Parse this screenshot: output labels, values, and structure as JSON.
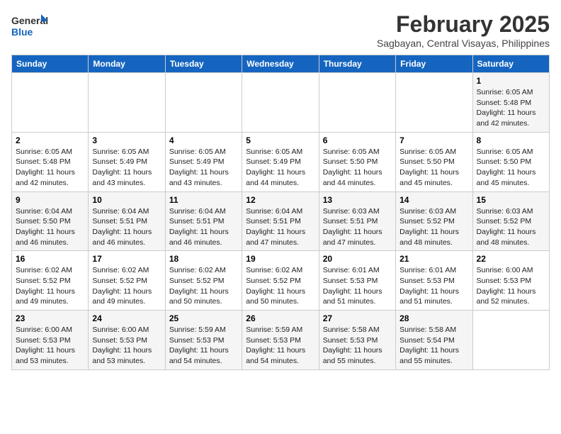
{
  "header": {
    "logo_line1": "General",
    "logo_line2": "Blue",
    "month": "February 2025",
    "location": "Sagbayan, Central Visayas, Philippines"
  },
  "weekdays": [
    "Sunday",
    "Monday",
    "Tuesday",
    "Wednesday",
    "Thursday",
    "Friday",
    "Saturday"
  ],
  "weeks": [
    [
      {
        "day": "",
        "info": ""
      },
      {
        "day": "",
        "info": ""
      },
      {
        "day": "",
        "info": ""
      },
      {
        "day": "",
        "info": ""
      },
      {
        "day": "",
        "info": ""
      },
      {
        "day": "",
        "info": ""
      },
      {
        "day": "1",
        "info": "Sunrise: 6:05 AM\nSunset: 5:48 PM\nDaylight: 11 hours and 42 minutes."
      }
    ],
    [
      {
        "day": "2",
        "info": "Sunrise: 6:05 AM\nSunset: 5:48 PM\nDaylight: 11 hours and 42 minutes."
      },
      {
        "day": "3",
        "info": "Sunrise: 6:05 AM\nSunset: 5:49 PM\nDaylight: 11 hours and 43 minutes."
      },
      {
        "day": "4",
        "info": "Sunrise: 6:05 AM\nSunset: 5:49 PM\nDaylight: 11 hours and 43 minutes."
      },
      {
        "day": "5",
        "info": "Sunrise: 6:05 AM\nSunset: 5:49 PM\nDaylight: 11 hours and 44 minutes."
      },
      {
        "day": "6",
        "info": "Sunrise: 6:05 AM\nSunset: 5:50 PM\nDaylight: 11 hours and 44 minutes."
      },
      {
        "day": "7",
        "info": "Sunrise: 6:05 AM\nSunset: 5:50 PM\nDaylight: 11 hours and 45 minutes."
      },
      {
        "day": "8",
        "info": "Sunrise: 6:05 AM\nSunset: 5:50 PM\nDaylight: 11 hours and 45 minutes."
      }
    ],
    [
      {
        "day": "9",
        "info": "Sunrise: 6:04 AM\nSunset: 5:50 PM\nDaylight: 11 hours and 46 minutes."
      },
      {
        "day": "10",
        "info": "Sunrise: 6:04 AM\nSunset: 5:51 PM\nDaylight: 11 hours and 46 minutes."
      },
      {
        "day": "11",
        "info": "Sunrise: 6:04 AM\nSunset: 5:51 PM\nDaylight: 11 hours and 46 minutes."
      },
      {
        "day": "12",
        "info": "Sunrise: 6:04 AM\nSunset: 5:51 PM\nDaylight: 11 hours and 47 minutes."
      },
      {
        "day": "13",
        "info": "Sunrise: 6:03 AM\nSunset: 5:51 PM\nDaylight: 11 hours and 47 minutes."
      },
      {
        "day": "14",
        "info": "Sunrise: 6:03 AM\nSunset: 5:52 PM\nDaylight: 11 hours and 48 minutes."
      },
      {
        "day": "15",
        "info": "Sunrise: 6:03 AM\nSunset: 5:52 PM\nDaylight: 11 hours and 48 minutes."
      }
    ],
    [
      {
        "day": "16",
        "info": "Sunrise: 6:02 AM\nSunset: 5:52 PM\nDaylight: 11 hours and 49 minutes."
      },
      {
        "day": "17",
        "info": "Sunrise: 6:02 AM\nSunset: 5:52 PM\nDaylight: 11 hours and 49 minutes."
      },
      {
        "day": "18",
        "info": "Sunrise: 6:02 AM\nSunset: 5:52 PM\nDaylight: 11 hours and 50 minutes."
      },
      {
        "day": "19",
        "info": "Sunrise: 6:02 AM\nSunset: 5:52 PM\nDaylight: 11 hours and 50 minutes."
      },
      {
        "day": "20",
        "info": "Sunrise: 6:01 AM\nSunset: 5:53 PM\nDaylight: 11 hours and 51 minutes."
      },
      {
        "day": "21",
        "info": "Sunrise: 6:01 AM\nSunset: 5:53 PM\nDaylight: 11 hours and 51 minutes."
      },
      {
        "day": "22",
        "info": "Sunrise: 6:00 AM\nSunset: 5:53 PM\nDaylight: 11 hours and 52 minutes."
      }
    ],
    [
      {
        "day": "23",
        "info": "Sunrise: 6:00 AM\nSunset: 5:53 PM\nDaylight: 11 hours and 53 minutes."
      },
      {
        "day": "24",
        "info": "Sunrise: 6:00 AM\nSunset: 5:53 PM\nDaylight: 11 hours and 53 minutes."
      },
      {
        "day": "25",
        "info": "Sunrise: 5:59 AM\nSunset: 5:53 PM\nDaylight: 11 hours and 54 minutes."
      },
      {
        "day": "26",
        "info": "Sunrise: 5:59 AM\nSunset: 5:53 PM\nDaylight: 11 hours and 54 minutes."
      },
      {
        "day": "27",
        "info": "Sunrise: 5:58 AM\nSunset: 5:53 PM\nDaylight: 11 hours and 55 minutes."
      },
      {
        "day": "28",
        "info": "Sunrise: 5:58 AM\nSunset: 5:54 PM\nDaylight: 11 hours and 55 minutes."
      },
      {
        "day": "",
        "info": ""
      }
    ]
  ]
}
